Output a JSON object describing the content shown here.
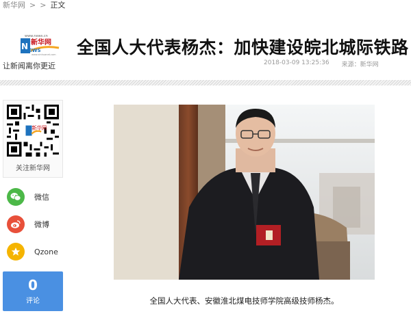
{
  "breadcrumb": {
    "items": [
      "新华网",
      ">",
      ">",
      "正文"
    ]
  },
  "logo": {
    "domain_text": "www.news.cn",
    "brand_text": "新华网",
    "mark_text": "NEWS",
    "slogan": "让新闻离你更近",
    "url_text": "www.xinhuanet.com"
  },
  "article": {
    "title": "全国人大代表杨杰：加快建设皖北城际铁路",
    "datetime": "2018-03-09 13:25:36",
    "source": "来源：新华网",
    "caption": "全国人大代表、安徽淮北煤电技师学院高级技师杨杰。"
  },
  "sidebar": {
    "qr_label": "关注新华网",
    "share": [
      {
        "label": "微信",
        "icon": "wechat-icon",
        "color": "#4cb848"
      },
      {
        "label": "微博",
        "icon": "weibo-icon",
        "color": "#e8503a"
      },
      {
        "label": "Qzone",
        "icon": "qzone-icon",
        "color": "#f5b400"
      }
    ],
    "comment": {
      "count": "0",
      "label": "评论",
      "color": "#4a90e2"
    }
  }
}
